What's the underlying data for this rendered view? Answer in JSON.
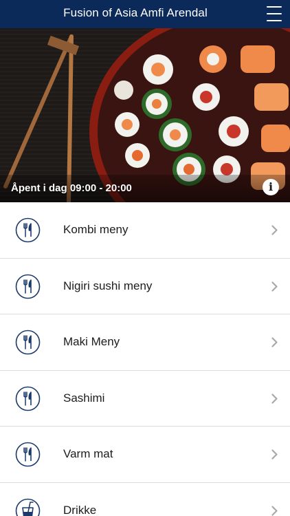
{
  "header": {
    "title": "Fusion of Asia Amfi Arendal",
    "menu_icon": "hamburger-menu-icon"
  },
  "hero": {
    "opening_hours": "Åpent i dag 09:00 - 20:00",
    "info_icon": "info-icon"
  },
  "colors": {
    "header_bg": "#0b2a5a",
    "icon_stroke": "#1b3a6b",
    "chevron": "#a8a8a8"
  },
  "menu": {
    "items": [
      {
        "label": "Kombi meny",
        "icon": "cutlery-icon"
      },
      {
        "label": "Nigiri sushi meny",
        "icon": "cutlery-icon"
      },
      {
        "label": "Maki Meny",
        "icon": "cutlery-icon"
      },
      {
        "label": "Sashimi",
        "icon": "cutlery-icon"
      },
      {
        "label": "Varm mat",
        "icon": "cutlery-icon"
      },
      {
        "label": "Drikke",
        "icon": "drink-icon"
      }
    ]
  }
}
